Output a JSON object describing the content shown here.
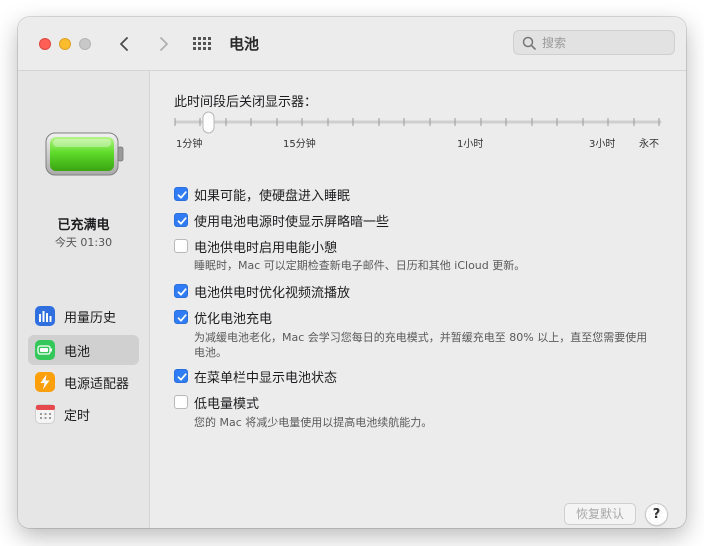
{
  "window": {
    "title": "电池"
  },
  "search": {
    "placeholder": "搜索",
    "value": ""
  },
  "sidebar": {
    "status_title": "已充满电",
    "status_time": "今天 01:30",
    "items": [
      {
        "label": "用量历史",
        "icon": "bar-chart-icon",
        "color": "#2f6fe0",
        "selected": false
      },
      {
        "label": "电池",
        "icon": "battery-icon",
        "color": "#34c759",
        "selected": true
      },
      {
        "label": "电源适配器",
        "icon": "lightning-icon",
        "color": "#ff9f0a",
        "selected": false
      },
      {
        "label": "定时",
        "icon": "calendar-icon",
        "color": "#e9e9e9",
        "selected": false
      }
    ]
  },
  "display_sleep": {
    "title": "此时间段后关闭显示器：",
    "ticks": [
      "1分钟",
      "15分钟",
      "1小时",
      "3小时",
      "永不"
    ],
    "value": "1分钟"
  },
  "options": [
    {
      "label": "如果可能，使硬盘进入睡眠",
      "checked": true
    },
    {
      "label": "使用电池电源时使显示屏略暗一些",
      "checked": true
    },
    {
      "label": "电池供电时启用电能小憩",
      "checked": false,
      "description": "睡眠时，Mac 可以定期检查新电子邮件、日历和其他 iCloud 更新。"
    },
    {
      "label": "电池供电时优化视频流播放",
      "checked": true
    },
    {
      "label": "优化电池充电",
      "checked": true,
      "description_lines": [
        "为减缓电池老化，Mac 会学习您每日的充电模式，并暂缓充电至 80% 以上，直至您需要使用",
        "电池。"
      ]
    },
    {
      "label": "在菜单栏中显示电池状态",
      "checked": true
    },
    {
      "label": "低电量模式",
      "checked": false,
      "description": "您的 Mac 将减少电量使用以提高电池续航能力。"
    }
  ],
  "buttons": {
    "restore": "恢复默认",
    "help": "?"
  },
  "colors": {
    "accent": "#2f7cf6",
    "battery_green": "#4cd01f"
  }
}
